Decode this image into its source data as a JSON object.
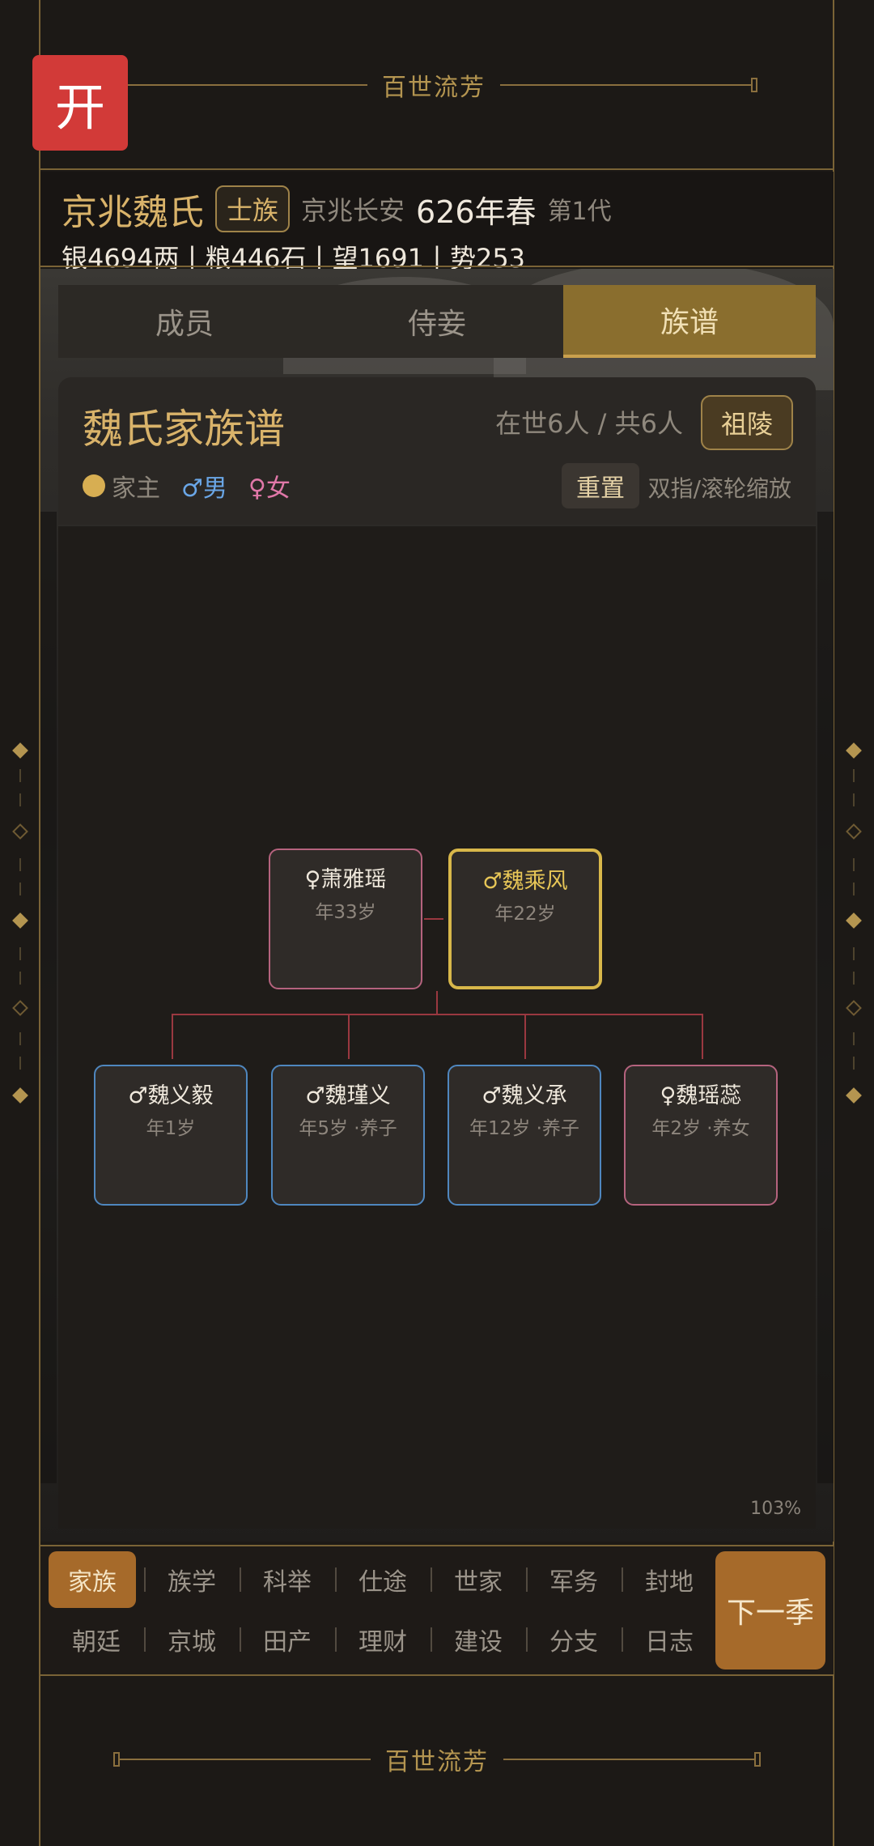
{
  "banner": {
    "title": "百世流芳"
  },
  "open_button": "开",
  "clan": {
    "name": "京兆魏氏",
    "rank": "士族",
    "location": "京兆长安",
    "year": "626年春",
    "generation": "第1代",
    "stats": "银4694两丨粮446石丨望1691丨势253"
  },
  "tabs": [
    {
      "label": "成员",
      "active": false
    },
    {
      "label": "侍妾",
      "active": false
    },
    {
      "label": "族谱",
      "active": true
    }
  ],
  "tree_card": {
    "title": "魏氏家族谱",
    "count": "在世6人 / 共6人",
    "tomb_button": "祖陵",
    "legend": {
      "head": "家主",
      "male": "♂男",
      "female": "♀女"
    },
    "reset_button": "重置",
    "zoom_hint": "双指/滚轮缩放",
    "zoom_level": "103%"
  },
  "members": {
    "spouse": {
      "name": "♀萧雅瑶",
      "age": "年33岁"
    },
    "head": {
      "name": "♂魏乘风",
      "age": "年22岁"
    },
    "children": [
      {
        "name": "♂魏义毅",
        "age": "年1岁",
        "gender": "m"
      },
      {
        "name": "♂魏瑾义",
        "age": "年5岁 ·养子",
        "gender": "m"
      },
      {
        "name": "♂魏义承",
        "age": "年12岁 ·养子",
        "gender": "m"
      },
      {
        "name": "♀魏瑶蕊",
        "age": "年2岁 ·养女",
        "gender": "f"
      }
    ]
  },
  "nav": {
    "row1": [
      "家族",
      "族学",
      "科举",
      "仕途",
      "世家",
      "军务",
      "封地"
    ],
    "row2": [
      "朝廷",
      "京城",
      "田产",
      "理财",
      "建设",
      "分支",
      "日志"
    ],
    "next": "下一季"
  },
  "colors": {
    "accent_gold": "#d9b36a",
    "open_red": "#d23a38",
    "male_blue": "#4f87bf",
    "female_pink": "#b5637e",
    "head_yellow": "#d8b74a",
    "active_tab": "#8a6e2e",
    "nav_active": "#a66a2a"
  }
}
